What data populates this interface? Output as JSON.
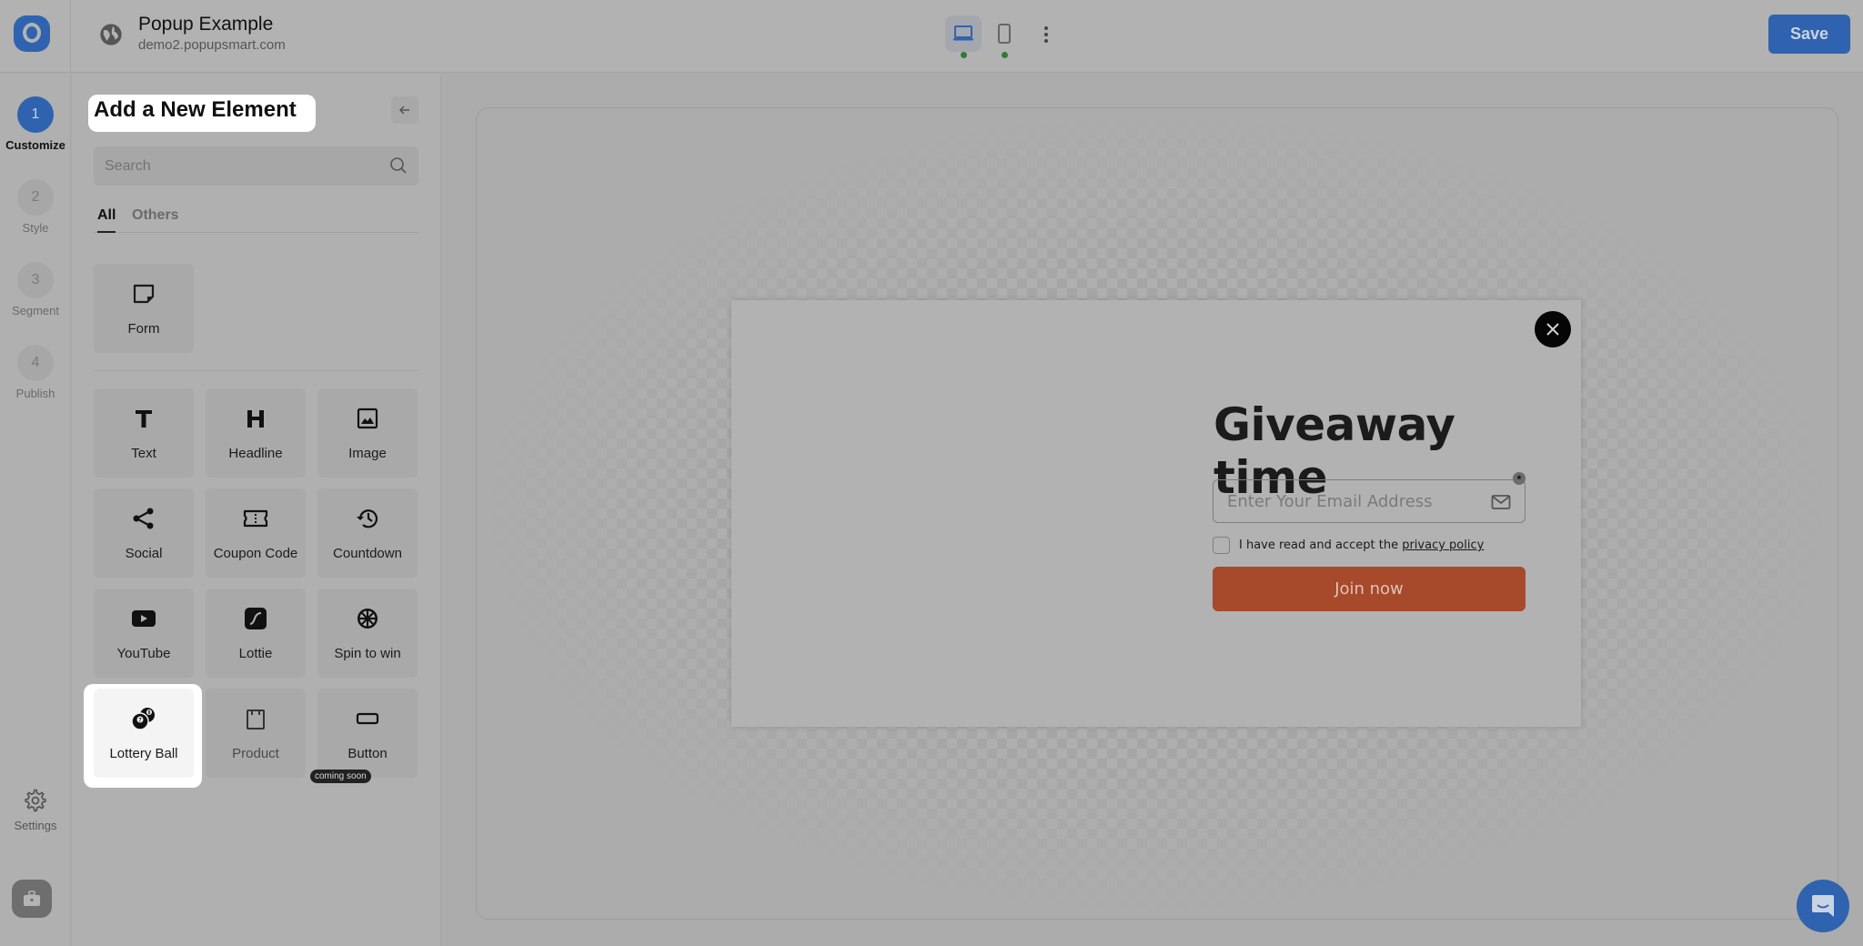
{
  "header": {
    "title": "Popup Example",
    "subtitle": "demo2.popupsmart.com",
    "save_label": "Save",
    "devices": [
      {
        "name": "desktop",
        "active": true
      },
      {
        "name": "mobile",
        "active": false
      }
    ]
  },
  "rail": {
    "steps": [
      {
        "number": "1",
        "label": "Customize",
        "active": true
      },
      {
        "number": "2",
        "label": "Style",
        "active": false
      },
      {
        "number": "3",
        "label": "Segment",
        "active": false
      },
      {
        "number": "4",
        "label": "Publish",
        "active": false
      }
    ],
    "settings_label": "Settings"
  },
  "panel": {
    "title": "Add a New Element",
    "search_placeholder": "Search",
    "tabs": [
      {
        "label": "All",
        "active": true
      },
      {
        "label": "Others",
        "active": false
      }
    ],
    "form_elements": [
      {
        "label": "Form",
        "icon": "form-icon"
      }
    ],
    "elements": [
      {
        "label": "Text",
        "icon": "text-icon"
      },
      {
        "label": "Headline",
        "icon": "headline-icon"
      },
      {
        "label": "Image",
        "icon": "image-icon"
      },
      {
        "label": "Social",
        "icon": "share-icon"
      },
      {
        "label": "Coupon Code",
        "icon": "ticket-icon"
      },
      {
        "label": "Countdown",
        "icon": "history-icon"
      },
      {
        "label": "YouTube",
        "icon": "youtube-icon"
      },
      {
        "label": "Lottie",
        "icon": "lottie-icon"
      },
      {
        "label": "Spin to win",
        "icon": "wheel-icon"
      },
      {
        "label": "Lottery Ball",
        "icon": "lottery-ball-icon",
        "highlighted": true
      },
      {
        "label": "Product",
        "icon": "product-icon",
        "disabled": true,
        "tooltip": "coming soon"
      },
      {
        "label": "Button",
        "icon": "button-icon"
      }
    ]
  },
  "popup": {
    "title": "Giveaway time",
    "email_placeholder": "Enter Your Email Address",
    "required_mark": "*",
    "consent_text": "I have read and accept the ",
    "consent_link": "privacy policy",
    "cta_label": "Join now"
  },
  "colors": {
    "brand": "#2f63b0",
    "cta": "#a7492b",
    "status_dot": "#2e7d32"
  }
}
